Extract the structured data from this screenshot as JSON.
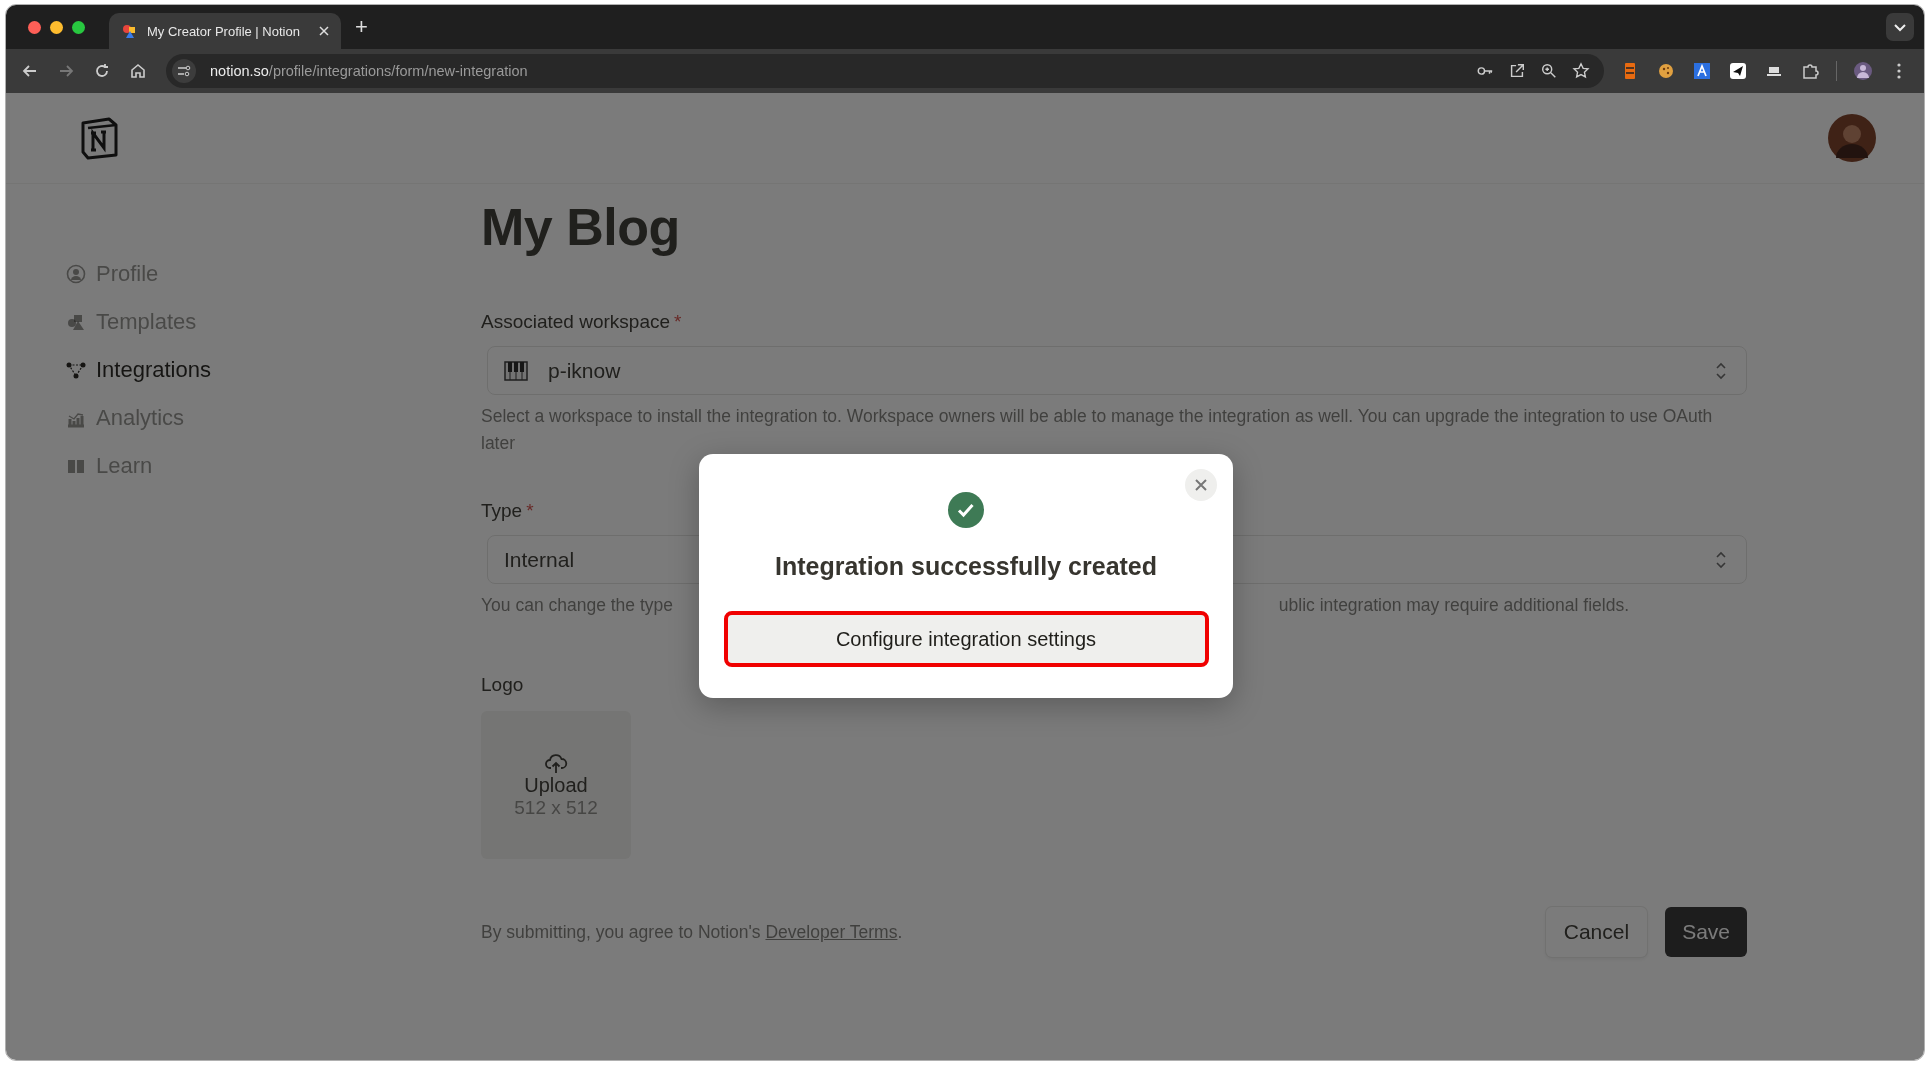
{
  "browser": {
    "tab_title": "My Creator Profile | Notion",
    "new_tab": "+",
    "url_host": "notion.so",
    "url_path": "/profile/integrations/form/new-integration"
  },
  "sidebar": {
    "items": [
      {
        "label": "Profile",
        "kind": "profile",
        "selected": false
      },
      {
        "label": "Templates",
        "kind": "templates",
        "selected": false
      },
      {
        "label": "Integrations",
        "kind": "integrations",
        "selected": true
      },
      {
        "label": "Analytics",
        "kind": "analytics",
        "selected": false
      },
      {
        "label": "Learn",
        "kind": "learn",
        "selected": false
      }
    ]
  },
  "page": {
    "title": "My Blog",
    "workspace": {
      "label": "Associated workspace",
      "mark": "*",
      "value": "p-iknow",
      "help": "Select a workspace to install the integration to. Workspace owners will be able to manage the integration as well. You can upgrade the integration to use OAuth later"
    },
    "type": {
      "label": "Type",
      "mark": "*",
      "value": "Internal",
      "help_left": "You can change the type ",
      "help_right": "ublic integration may require additional fields."
    },
    "logo": {
      "label": "Logo",
      "upload": "Upload",
      "size": "512 x 512"
    },
    "footer": {
      "text_before": "By submitting, you agree to Notion's ",
      "link": "Developer Terms",
      "text_after": "."
    },
    "buttons": {
      "cancel": "Cancel",
      "save": "Save"
    }
  },
  "dialog": {
    "title": "Integration successfully created",
    "button": "Configure integration settings",
    "highlighted": true
  }
}
